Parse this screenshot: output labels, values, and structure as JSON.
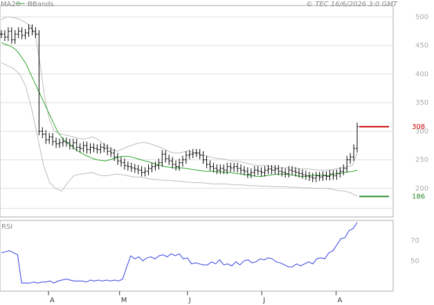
{
  "header": {
    "ma_label": "MA20",
    "bb_label": "BBands",
    "copyright": "© TEC 16/6/2026 3:0 GMT"
  },
  "colors": {
    "ma": "#2aa52a",
    "bbands": "#bbbbbb",
    "price": "#000000",
    "resistance": "#cc0000",
    "support": "#2a8c2a",
    "rsi": "#2f3ee0",
    "grid": "#dddddd"
  },
  "chart_data": [
    {
      "type": "ohlc",
      "name": "price",
      "yticks": [
        200,
        250,
        300,
        350,
        400,
        450,
        500
      ],
      "ylim": [
        150,
        520
      ],
      "x_month_labels": [
        "A",
        "M",
        "J",
        "J",
        "A"
      ],
      "x_month_at": [
        15,
        37,
        58,
        81,
        104
      ],
      "x_range": [
        0,
        120
      ],
      "levels": [
        {
          "label": "308",
          "value": 308,
          "kind": "resistance"
        },
        {
          "label": "186",
          "value": 186,
          "kind": "support"
        }
      ],
      "close": [
        470,
        465,
        475,
        460,
        470,
        475,
        468,
        472,
        480,
        475,
        470,
        300,
        295,
        285,
        290,
        282,
        278,
        280,
        282,
        280,
        275,
        280,
        272,
        270,
        275,
        268,
        272,
        270,
        268,
        272,
        270,
        265,
        262,
        255,
        248,
        245,
        240,
        238,
        236,
        234,
        232,
        228,
        230,
        235,
        238,
        240,
        245,
        260,
        252,
        248,
        242,
        238,
        245,
        250,
        258,
        260,
        262,
        262,
        258,
        250,
        242,
        238,
        235,
        232,
        235,
        232,
        238,
        236,
        238,
        235,
        232,
        230,
        225,
        228,
        232,
        230,
        228,
        232,
        234,
        232,
        234,
        230,
        228,
        226,
        232,
        230,
        228,
        226,
        224,
        222,
        220,
        218,
        222,
        220,
        223,
        221,
        225,
        222,
        226,
        230,
        235,
        250,
        255,
        270,
        308
      ],
      "ma20": [
        455,
        452,
        450,
        446,
        440,
        430,
        420,
        405,
        390,
        375,
        360,
        345,
        330,
        315,
        300,
        290,
        282,
        277,
        272,
        266,
        262,
        258,
        255,
        252,
        250,
        249,
        248,
        250,
        252,
        254,
        256,
        256,
        256,
        254,
        252,
        250,
        248,
        246,
        244,
        242,
        240,
        238,
        237,
        236,
        236,
        236,
        235,
        234,
        233,
        232,
        231,
        230,
        230,
        230,
        229,
        229,
        228,
        228,
        227,
        226,
        225,
        224,
        223,
        222,
        221,
        221,
        222,
        223,
        224,
        225,
        225,
        225,
        224,
        223,
        222,
        221,
        221,
        222,
        223,
        223,
        223,
        222,
        222,
        225,
        226,
        227,
        228,
        229,
        230,
        232
      ],
      "bb_upper": [
        495,
        500,
        500,
        498,
        495,
        490,
        485,
        470,
        420,
        360,
        320,
        300,
        296,
        294,
        292,
        290,
        288,
        286,
        288,
        290,
        286,
        280,
        272,
        268,
        265,
        268,
        272,
        275,
        278,
        280,
        280,
        278,
        275,
        272,
        268,
        264,
        262,
        262,
        264,
        266,
        262,
        260,
        258,
        256,
        254,
        252,
        252,
        250,
        248,
        248,
        246,
        244,
        242,
        240,
        240,
        240,
        238,
        236,
        236,
        236,
        236,
        236,
        234,
        234,
        234,
        233,
        232,
        232,
        232,
        233,
        235,
        236,
        238,
        240,
        262
      ],
      "bb_lower": [
        420,
        415,
        410,
        400,
        380,
        340,
        290,
        240,
        210,
        200,
        195,
        210,
        222,
        225,
        226,
        228,
        224,
        222,
        223,
        225,
        224,
        222,
        220,
        220,
        218,
        216,
        215,
        214,
        214,
        213,
        212,
        211,
        210,
        210,
        209,
        208,
        208,
        208,
        207,
        206,
        206,
        205,
        205,
        204,
        204,
        203,
        203,
        203,
        202,
        202,
        201,
        201,
        200,
        200,
        200,
        198,
        196,
        195,
        192,
        186
      ]
    },
    {
      "type": "line",
      "name": "RSI",
      "yticks": [
        50,
        70
      ],
      "ylim": [
        20,
        90
      ],
      "values": [
        58,
        59,
        60,
        58,
        56,
        28,
        28,
        28,
        29,
        28,
        29,
        29,
        30,
        28,
        30,
        31,
        32,
        31,
        30,
        30,
        30,
        29,
        31,
        30,
        31,
        30,
        31,
        30,
        31,
        30,
        32,
        44,
        55,
        52,
        54,
        50,
        53,
        54,
        52,
        55,
        56,
        54,
        57,
        55,
        57,
        52,
        53,
        47,
        48,
        47,
        46,
        46,
        49,
        47,
        51,
        46,
        47,
        45,
        49,
        46,
        50,
        51,
        48,
        49,
        52,
        51,
        53,
        52,
        49,
        48,
        46,
        44,
        44,
        47,
        45,
        47,
        49,
        47,
        52,
        53,
        52,
        58,
        60,
        66,
        72,
        73,
        80,
        82,
        88
      ]
    }
  ]
}
